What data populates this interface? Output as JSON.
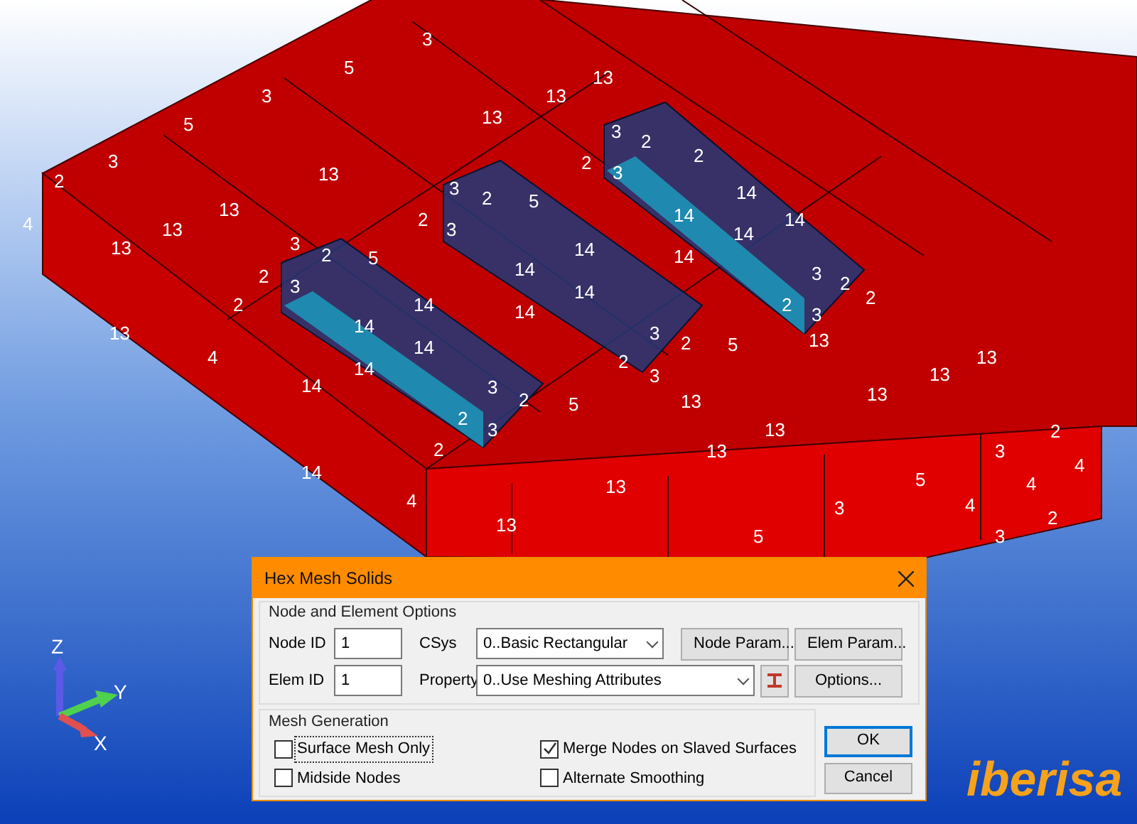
{
  "viewport": {
    "node_labels": [
      "2",
      "3",
      "5",
      "3",
      "5",
      "3",
      "13",
      "4",
      "13",
      "13",
      "13",
      "13",
      "13",
      "13",
      "3",
      "2",
      "2",
      "2",
      "3",
      "14",
      "14",
      "14",
      "14",
      "14",
      "3",
      "2",
      "2",
      "5",
      "3",
      "14",
      "14",
      "14",
      "14",
      "3",
      "2",
      "2",
      "5",
      "3",
      "14",
      "14",
      "14",
      "14",
      "2",
      "13",
      "4",
      "14",
      "3",
      "2",
      "2",
      "2",
      "3",
      "3",
      "2",
      "2",
      "3",
      "5",
      "13",
      "3",
      "2",
      "2",
      "3",
      "5",
      "2",
      "13",
      "13",
      "13",
      "13",
      "13",
      "13",
      "2",
      "3",
      "4",
      "14",
      "4",
      "13",
      "5",
      "3",
      "4",
      "4",
      "13",
      "3",
      "2",
      "5"
    ]
  },
  "axes": {
    "x": "X",
    "y": "Y",
    "z": "Z"
  },
  "logo": "iberisa",
  "dialog": {
    "title": "Hex Mesh Solids",
    "node_element_options": {
      "title": "Node and Element Options",
      "node_id": {
        "label": "Node ID",
        "value": "1"
      },
      "elem_id": {
        "label": "Elem ID",
        "value": "1"
      },
      "csys": {
        "label": "CSys",
        "value": "0..Basic Rectangular"
      },
      "property": {
        "label": "Property",
        "value": "0..Use Meshing Attributes"
      },
      "buttons": [
        "Node Param...",
        "Elem Param...",
        "Options..."
      ]
    },
    "mesh_generation": {
      "title": "Mesh Generation",
      "options": [
        {
          "label": "Surface Mesh Only",
          "checked": false,
          "focused": true
        },
        {
          "label": "Merge Nodes on Slaved Surfaces",
          "checked": true,
          "focused": false
        },
        {
          "label": "Midside Nodes",
          "checked": false,
          "focused": false
        },
        {
          "label": "Alternate Smoothing",
          "checked": false,
          "focused": false
        }
      ]
    },
    "buttons": [
      {
        "label": "OK",
        "default": true
      },
      {
        "label": "Cancel",
        "default": false
      }
    ]
  }
}
